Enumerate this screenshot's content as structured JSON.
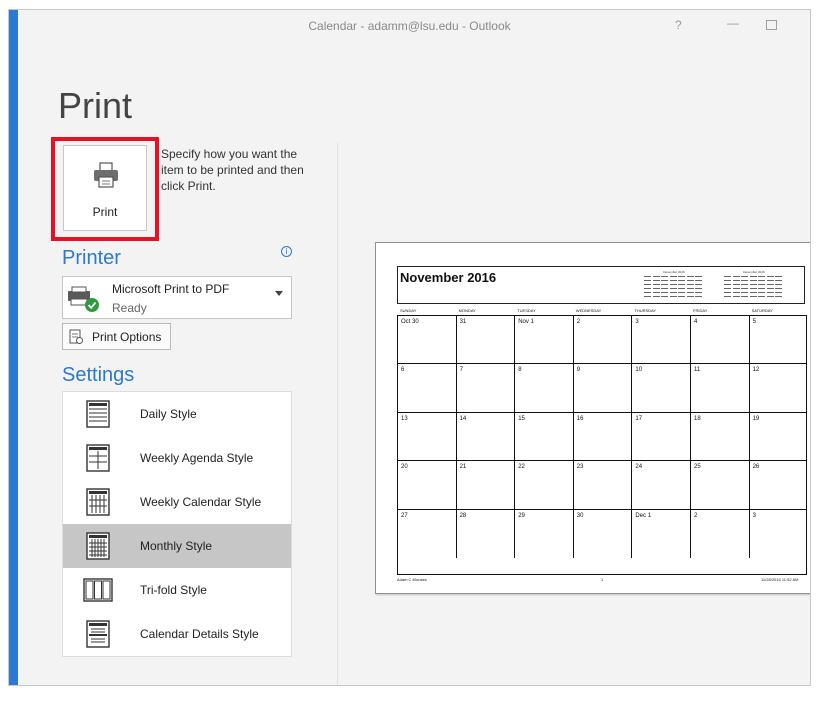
{
  "window": {
    "title": "Calendar - adamm@lsu.edu  -  Outlook",
    "help_glyph": "?",
    "minimize_glyph": "—"
  },
  "page": {
    "heading": "Print"
  },
  "print_button": {
    "label": "Print",
    "icon": "printer-icon"
  },
  "print_description": "Specify how you want the item to be printed and then click Print.",
  "printer": {
    "heading": "Printer",
    "info_glyph": "i",
    "selected_name": "Microsoft Print to PDF",
    "selected_status": "Ready",
    "options_label": "Print Options"
  },
  "settings": {
    "heading": "Settings",
    "styles": [
      {
        "label": "Daily Style",
        "icon": "daily-style-icon",
        "selected": false
      },
      {
        "label": "Weekly Agenda Style",
        "icon": "weekly-agenda-style-icon",
        "selected": false
      },
      {
        "label": "Weekly Calendar Style",
        "icon": "weekly-calendar-style-icon",
        "selected": false
      },
      {
        "label": "Monthly Style",
        "icon": "monthly-style-icon",
        "selected": true
      },
      {
        "label": "Tri-fold Style",
        "icon": "trifold-style-icon",
        "selected": false
      },
      {
        "label": "Calendar Details Style",
        "icon": "calendar-details-style-icon",
        "selected": false
      }
    ]
  },
  "preview": {
    "title": "November 2016",
    "mini_cal_1": "November 2016",
    "mini_cal_2": "December 2016",
    "days": [
      "SUNDAY",
      "MONDAY",
      "TUESDAY",
      "WEDNESDAY",
      "THURSDAY",
      "FRIDAY",
      "SATURDAY"
    ],
    "weeks": [
      [
        "Oct 30",
        "31",
        "Nov 1",
        "2",
        "3",
        "4",
        "5"
      ],
      [
        "6",
        "7",
        "8",
        "9",
        "10",
        "11",
        "12"
      ],
      [
        "13",
        "14",
        "15",
        "16",
        "17",
        "18",
        "19"
      ],
      [
        "20",
        "21",
        "22",
        "23",
        "24",
        "25",
        "26"
      ],
      [
        "27",
        "28",
        "29",
        "30",
        "Dec 1",
        "2",
        "3"
      ]
    ],
    "footer_left": "Adam C Morales",
    "footer_center": "1",
    "footer_right": "11/28/2016 11:52 AM"
  },
  "colors": {
    "accent": "#2b79d0",
    "highlight_border": "#e81123",
    "selected_row": "#c6c6c6"
  }
}
